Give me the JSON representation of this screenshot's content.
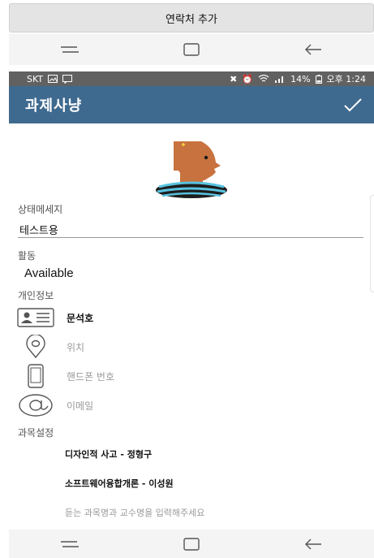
{
  "top_bar": {
    "add_contact_label": "연락처 추가"
  },
  "status_bar": {
    "carrier": "SKT",
    "battery": "14%",
    "time": "오후 1:24"
  },
  "app_bar": {
    "title": "과제사냥",
    "confirm_icon": "check-icon"
  },
  "status_message": {
    "label": "상태메세지",
    "value": "테스트용"
  },
  "activity": {
    "label": "활동",
    "value": "Available"
  },
  "personal_info": {
    "label": "개인정보",
    "name": "문석호",
    "location_placeholder": "위치",
    "phone_placeholder": "핸드폰 번호",
    "email_placeholder": "이메일"
  },
  "course_settings": {
    "label": "과목설정",
    "courses": [
      "디자인적 사고 - 정형구",
      "소프트웨어융합개론 - 이성원"
    ],
    "input_placeholder": "듣는 과목명과 교수명을 입력해주세요"
  },
  "colors": {
    "app_bar": "#3f6a8f",
    "status_bar": "#616161",
    "avatar_skin": "#c8723f",
    "avatar_shirt": "#1d1d1d",
    "avatar_stripe": "#58c3e0"
  }
}
